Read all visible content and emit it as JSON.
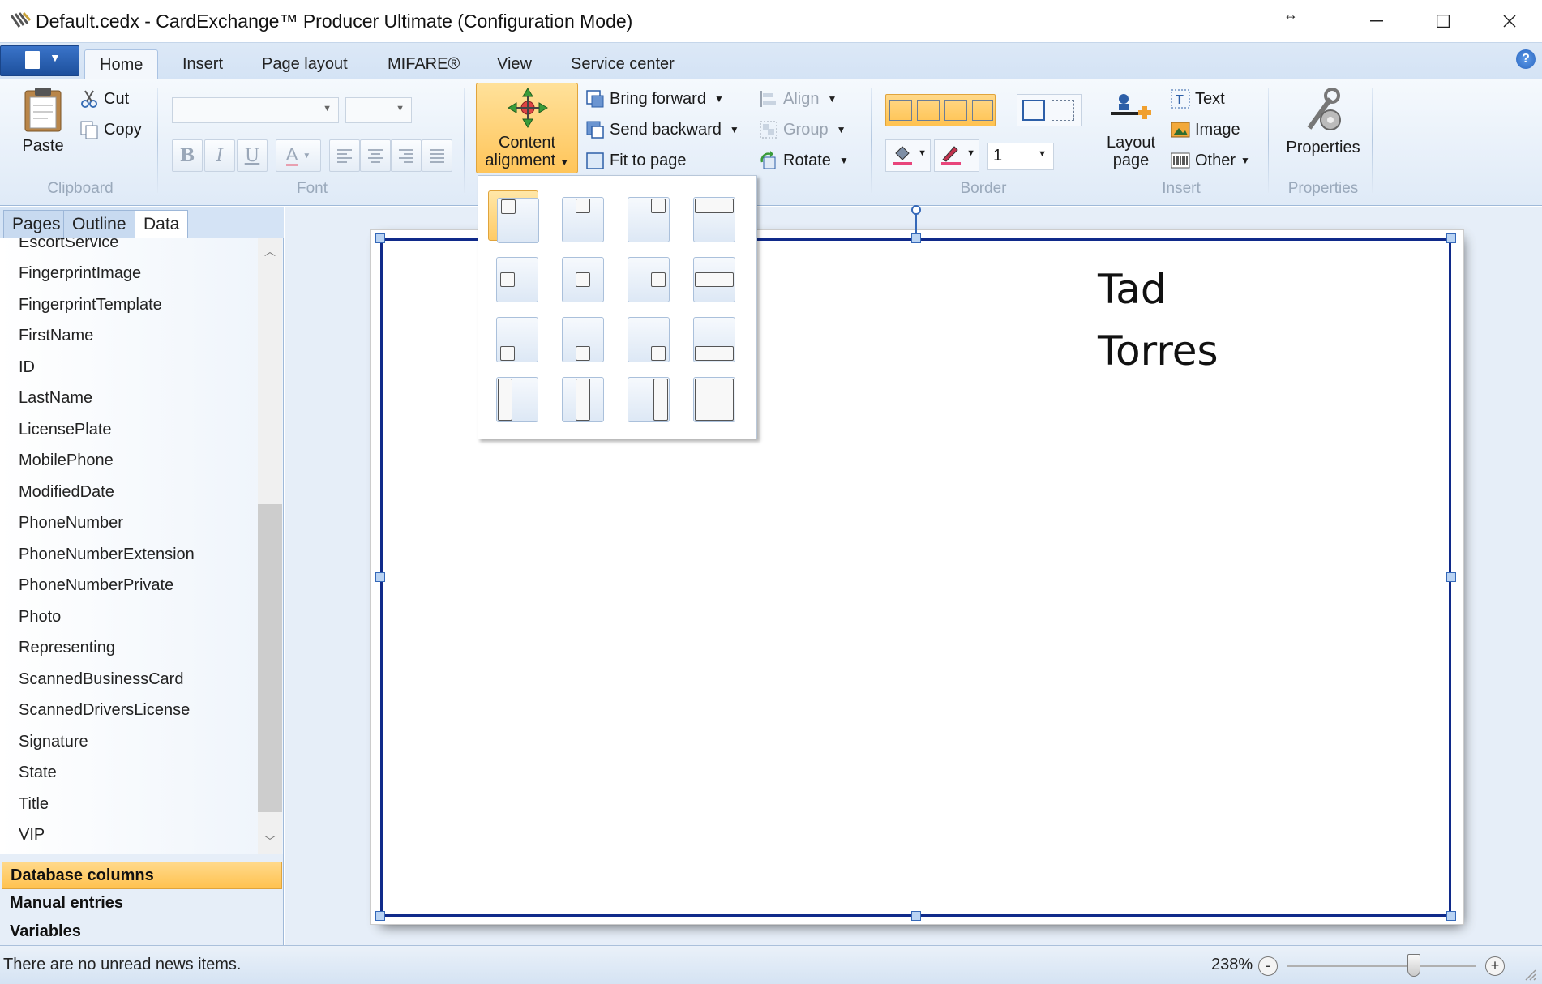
{
  "window": {
    "title": "Default.cedx - CardExchange™ Producer Ultimate (Configuration Mode)",
    "resize_glyph": "↔",
    "minimize": "—",
    "maximize": "☐",
    "close": "✕"
  },
  "ribbon_tabs": [
    "Home",
    "Insert",
    "Page layout",
    "MIFARE®",
    "View",
    "Service center"
  ],
  "active_tab": "Home",
  "help_label": "?",
  "clipboard": {
    "paste": "Paste",
    "cut": "Cut",
    "copy": "Copy",
    "group_label": "Clipboard"
  },
  "font": {
    "family_value": "",
    "size_value": "",
    "bold": "B",
    "italic": "I",
    "underline": "U",
    "color": "A",
    "group_label": "Font"
  },
  "arrange": {
    "content_alignment_line1": "Content",
    "content_alignment_line2": "alignment",
    "bring_forward": "Bring forward",
    "send_backward": "Send backward",
    "fit_to_page": "Fit to page",
    "align": "Align",
    "group": "Group",
    "rotate": "Rotate"
  },
  "border": {
    "width_value": "1",
    "group_label": "Border"
  },
  "insert": {
    "layout_page_line1": "Layout",
    "layout_page_line2": "page",
    "text": "Text",
    "image": "Image",
    "other": "Other",
    "group_label": "Insert"
  },
  "properties": {
    "label": "Properties",
    "group_label": "Properties"
  },
  "panel_tabs": [
    "Pages",
    "Outline",
    "Data"
  ],
  "active_panel_tab": "Data",
  "data_fields": [
    "EscortService",
    "FingerprintImage",
    "FingerprintTemplate",
    "FirstName",
    "ID",
    "LastName",
    "LicensePlate",
    "MobilePhone",
    "ModifiedDate",
    "PhoneNumber",
    "PhoneNumberExtension",
    "PhoneNumberPrivate",
    "Photo",
    "Representing",
    "ScannedBusinessCard",
    "ScannedDriversLicense",
    "Signature",
    "State",
    "Title",
    "VIP"
  ],
  "data_sections": [
    "Database columns",
    "Manual entries",
    "Variables"
  ],
  "active_section": "Database columns",
  "card": {
    "first_name": "Tad",
    "last_name": "Torres"
  },
  "status": {
    "news": "There are no unread news items.",
    "zoom": "238%",
    "zoom_out": "-",
    "zoom_in": "+"
  },
  "colors": {
    "accent_orange": "#ffc55a",
    "selection_border": "#102a8a",
    "ribbon_blue": "#dfeaf7"
  }
}
